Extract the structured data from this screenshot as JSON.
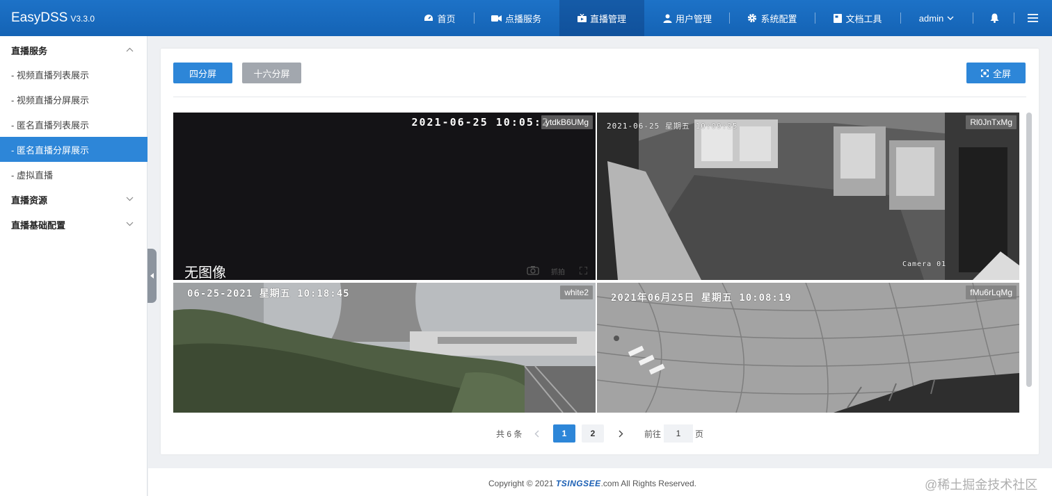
{
  "app": {
    "name": "EasyDSS",
    "version": "V3.3.0"
  },
  "nav": {
    "home": "首页",
    "vod": "点播服务",
    "live": "直播管理",
    "users": "用户管理",
    "system": "系统配置",
    "docs": "文档工具",
    "user": "admin"
  },
  "sidebar": {
    "group_live_service": "直播服务",
    "items": [
      "- 视频直播列表展示",
      "- 视频直播分屏展示",
      "- 匿名直播列表展示",
      "- 匿名直播分屏展示",
      "- 虚拟直播"
    ],
    "active_index": 3,
    "group_live_resource": "直播资源",
    "group_live_config": "直播基础配置"
  },
  "toolbar": {
    "four": "四分屏",
    "sixteen": "十六分屏",
    "fullscreen": "全屏"
  },
  "screens": [
    {
      "tag": "ytdkB6UMg",
      "osd_time": "2021-06-25  10:05:2",
      "osd_note": "无图像",
      "osd_bottom": "抓拍"
    },
    {
      "tag": "Rl0JnTxMg",
      "osd_time": "2021-06-25 星期五 10:09:25",
      "osd_cam": "Camera 01"
    },
    {
      "tag": "white2",
      "osd_time": "06-25-2021  星期五  10:18:45"
    },
    {
      "tag": "fMu6rLqMg",
      "osd_time": "2021年06月25日   星期五   10:08:19"
    }
  ],
  "pagination": {
    "total": "共 6 条",
    "pages": [
      "1",
      "2"
    ],
    "current": "1",
    "goto": "前往",
    "goto_value": "1",
    "page_suffix": "页"
  },
  "footer": {
    "pre": "Copyright © 2021 ",
    "logo": "TSINGSEE",
    "post": ".com All Rights Reserved.",
    "watermark": "@稀土掘金技术社区"
  },
  "colors": {
    "primary": "#2d86d8",
    "topbar": "#1463b5",
    "gray_button": "#a2a7ae"
  }
}
